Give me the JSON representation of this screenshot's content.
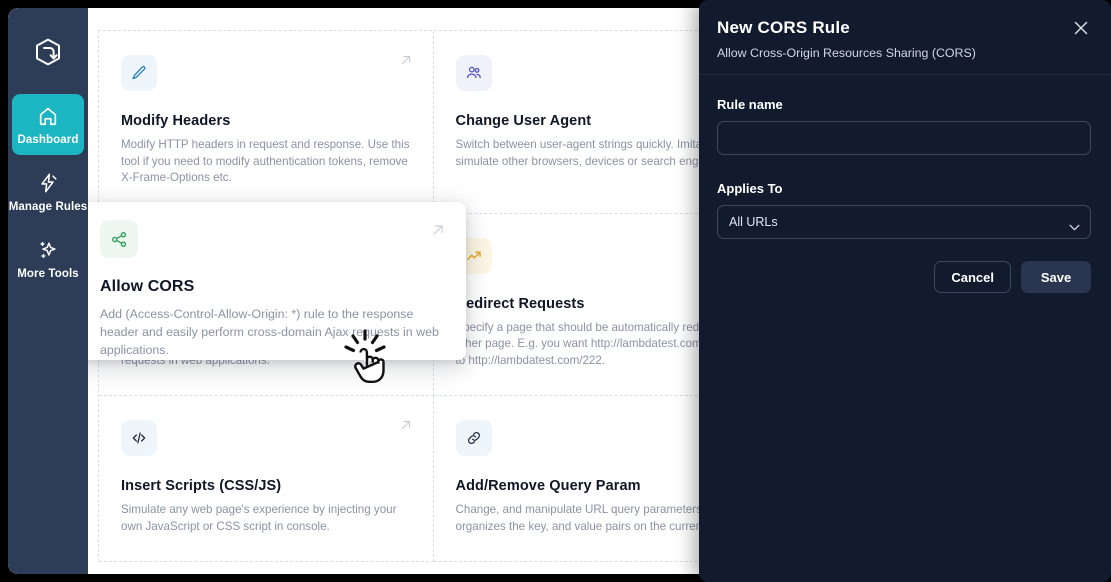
{
  "sidebar": {
    "logo_icon": "hexagon-arrow-logo",
    "items": [
      {
        "label": "Dashboard",
        "icon": "home-icon",
        "active": true
      },
      {
        "label": "Manage Rules",
        "icon": "lightning-icon",
        "active": false
      },
      {
        "label": "More Tools",
        "icon": "sparkles-icon",
        "active": false
      }
    ]
  },
  "cards": [
    {
      "title": "Modify Headers",
      "desc": "Modify HTTP headers in request and response. Use this tool if you need to modify authentication tokens, remove X-Frame-Options etc.",
      "icon": "pencil-icon"
    },
    {
      "title": "Change User Agent",
      "desc": "Switch between user-agent strings quickly. Imitate, s simulate other browsers, devices or search engine sp",
      "icon": "users-icon"
    },
    {
      "title": "Allow CORS",
      "desc": "Add (Access-Control-Allow-Origin: *) rule to the response header and easily perform cross-domain Ajax requests in web applications.",
      "icon": "share-nodes-icon"
    },
    {
      "title": "Redirect Requests",
      "desc": "Specify a page that should be automatically redirect other page. E.g. you want http://lambdatest.com/1 direct to http://lambdatest.com/222.",
      "icon": "trending-arrow-icon"
    },
    {
      "title": "Insert Scripts (CSS/JS)",
      "desc": "Simulate any web page's experience by injecting your own JavaScript or CSS script in console.",
      "icon": "code-icon"
    },
    {
      "title": "Add/Remove Query Param",
      "desc": "Change, and manipulate URL query parameters. It read organizes the key, and value pairs on the current web",
      "icon": "link-icon"
    }
  ],
  "highlight_card": {
    "title": "Allow CORS",
    "desc": "Add (Access-Control-Allow-Origin: *) rule to the response header and easily perform cross-domain Ajax requests in web applications.",
    "icon": "share-nodes-icon",
    "open_icon": "arrow-up-right-icon"
  },
  "cursor": {
    "icon": "click-pointer-cursor"
  },
  "panel": {
    "title": "New CORS Rule",
    "subtitle": "Allow Cross-Origin Resources Sharing (CORS)",
    "close_icon": "close-icon",
    "rule_name": {
      "label": "Rule name",
      "value": "",
      "placeholder": ""
    },
    "applies_to": {
      "label": "Applies To",
      "selected": "All URLs",
      "options": [
        "All URLs"
      ],
      "chevron_icon": "chevron-down-icon"
    },
    "buttons": {
      "cancel": "Cancel",
      "save": "Save"
    }
  },
  "colors": {
    "sidebar_bg": "#2D3D57",
    "accent_teal": "#1BB6C1",
    "panel_bg": "#121B2E",
    "save_btn": "#2A3550",
    "card_title": "#0f1625",
    "card_desc": "#8a93a3"
  }
}
